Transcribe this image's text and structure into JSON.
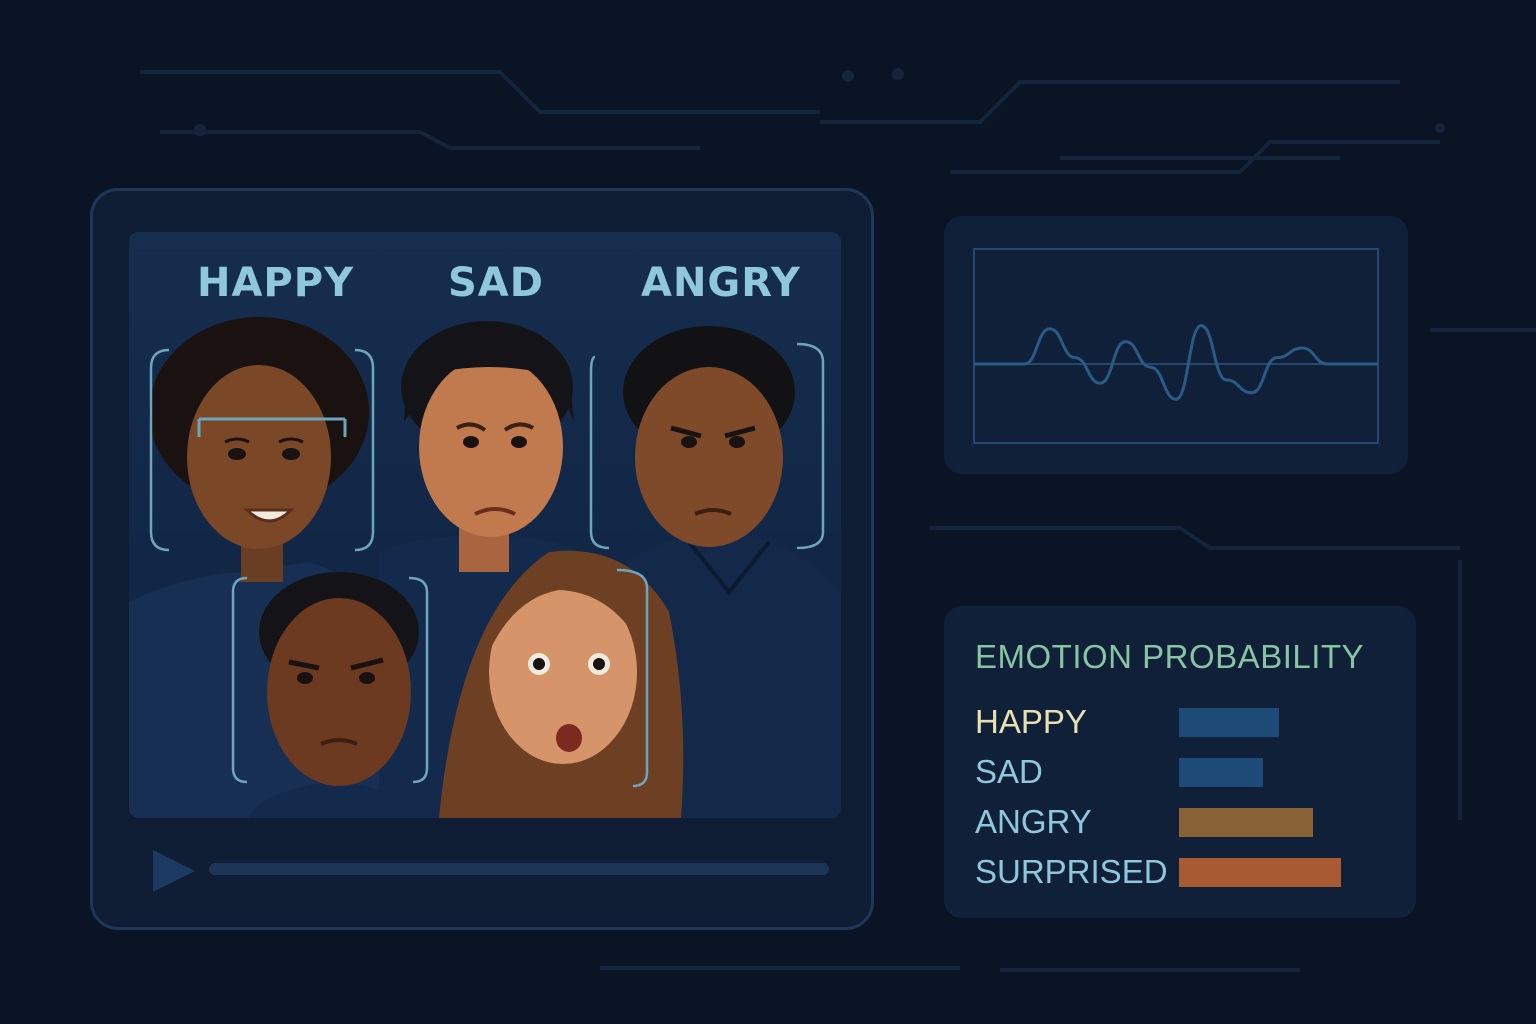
{
  "video": {
    "labels": [
      "HAPPY",
      "SAD",
      "ANGRY"
    ]
  },
  "waveform": {
    "points": [
      0,
      0,
      0,
      0.55,
      0.1,
      -0.3,
      0.35,
      -0.05,
      -0.55,
      0.6,
      -0.25,
      -0.45,
      0.1,
      0.25,
      0,
      0,
      0
    ]
  },
  "emotion_panel": {
    "title": "EMOTION PROBABILITY",
    "items": [
      {
        "label": "HAPPY",
        "value": 0.62,
        "label_color": "#e8e0b0",
        "bar_color": "#1e4a78"
      },
      {
        "label": "SAD",
        "value": 0.52,
        "label_color": "#8fc8dc",
        "bar_color": "#1e4a78"
      },
      {
        "label": "ANGRY",
        "value": 0.83,
        "label_color": "#8fc8dc",
        "bar_color": "#8a6238"
      },
      {
        "label": "SURPRISED",
        "value": 1.0,
        "label_color": "#8fc8dc",
        "bar_color": "#a85a32"
      }
    ]
  },
  "colors": {
    "background": "#0a1424",
    "panel": "#0f2038",
    "accent": "#8fc8dc",
    "wave": "#2a5a86"
  }
}
